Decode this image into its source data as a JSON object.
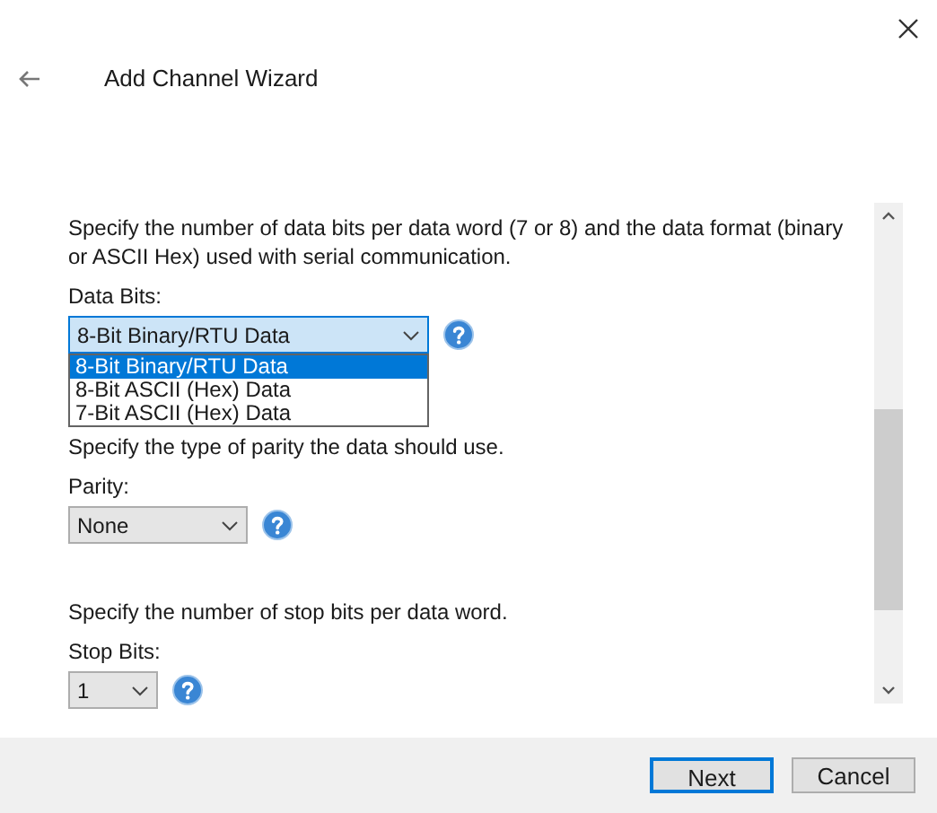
{
  "window": {
    "title": "Add Channel Wizard"
  },
  "sections": [
    {
      "description": "Specify the number of data bits per data word (7 or 8) and the data format (binary or ASCII Hex) used with serial communication.",
      "label": "Data Bits:",
      "select": {
        "value": "8-Bit Binary/RTU Data",
        "expanded": true,
        "options": [
          {
            "label": "8-Bit Binary/RTU Data",
            "selected": true
          },
          {
            "label": "8-Bit ASCII (Hex) Data",
            "selected": false
          },
          {
            "label": "7-Bit ASCII (Hex) Data",
            "selected": false
          }
        ]
      }
    },
    {
      "description": "Specify the type of parity the data should use.",
      "label": "Parity:",
      "select": {
        "value": "None",
        "expanded": false
      }
    },
    {
      "description": "Specify the number of stop bits per data word.",
      "label": "Stop Bits:",
      "select": {
        "value": "1",
        "expanded": false
      }
    }
  ],
  "buttons": [
    {
      "label": "Next",
      "default": true
    },
    {
      "label": "Cancel",
      "default": false
    }
  ]
}
